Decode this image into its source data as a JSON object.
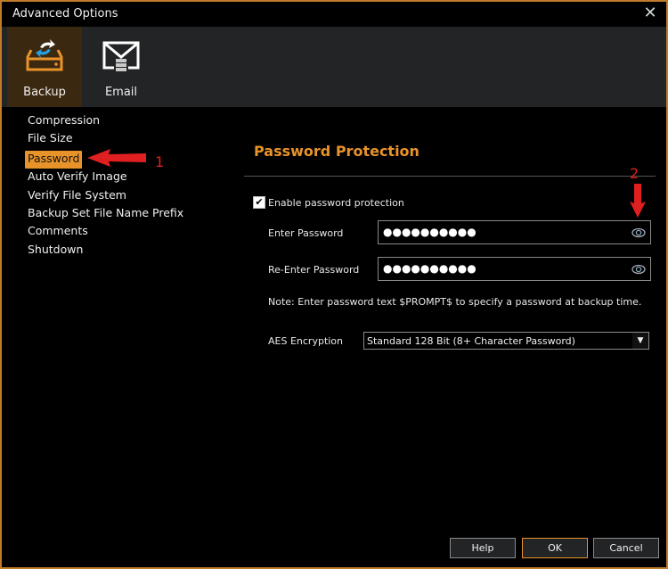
{
  "window": {
    "title": "Advanced Options",
    "close_icon": "close-icon",
    "accent_color": "#e8932a",
    "border_color": "#c07a2c"
  },
  "ribbon": {
    "tabs": [
      {
        "label": "Backup",
        "icon": "backup-drive-icon",
        "selected": true
      },
      {
        "label": "Email",
        "icon": "email-icon",
        "selected": false
      }
    ]
  },
  "nav": {
    "items": [
      {
        "label": "Compression",
        "selected": false
      },
      {
        "label": "File Size",
        "selected": false
      },
      {
        "label": "Password",
        "selected": true
      },
      {
        "label": "Auto Verify Image",
        "selected": false
      },
      {
        "label": "Verify File System",
        "selected": false
      },
      {
        "label": "Backup Set File Name Prefix",
        "selected": false
      },
      {
        "label": "Comments",
        "selected": false
      },
      {
        "label": "Shutdown",
        "selected": false
      }
    ]
  },
  "annotations": {
    "marker_1": "1",
    "marker_2": "2",
    "color": "#e02020"
  },
  "panel": {
    "title": "Password Protection",
    "enable_checkbox": {
      "label": "Enable password protection",
      "checked": true,
      "check_glyph": "✔"
    },
    "enter_password": {
      "label": "Enter Password",
      "value": "●●●●●●●●●●"
    },
    "reenter_password": {
      "label": "Re-Enter Password",
      "value": "●●●●●●●●●●"
    },
    "note": "Note: Enter password text $PROMPT$ to specify a password at backup time.",
    "aes": {
      "label": "AES Encryption",
      "selected": "Standard 128 Bit (8+ Character Password)",
      "caret": "▼"
    }
  },
  "footer": {
    "help_label": "Help",
    "ok_label": "OK",
    "cancel_label": "Cancel"
  }
}
